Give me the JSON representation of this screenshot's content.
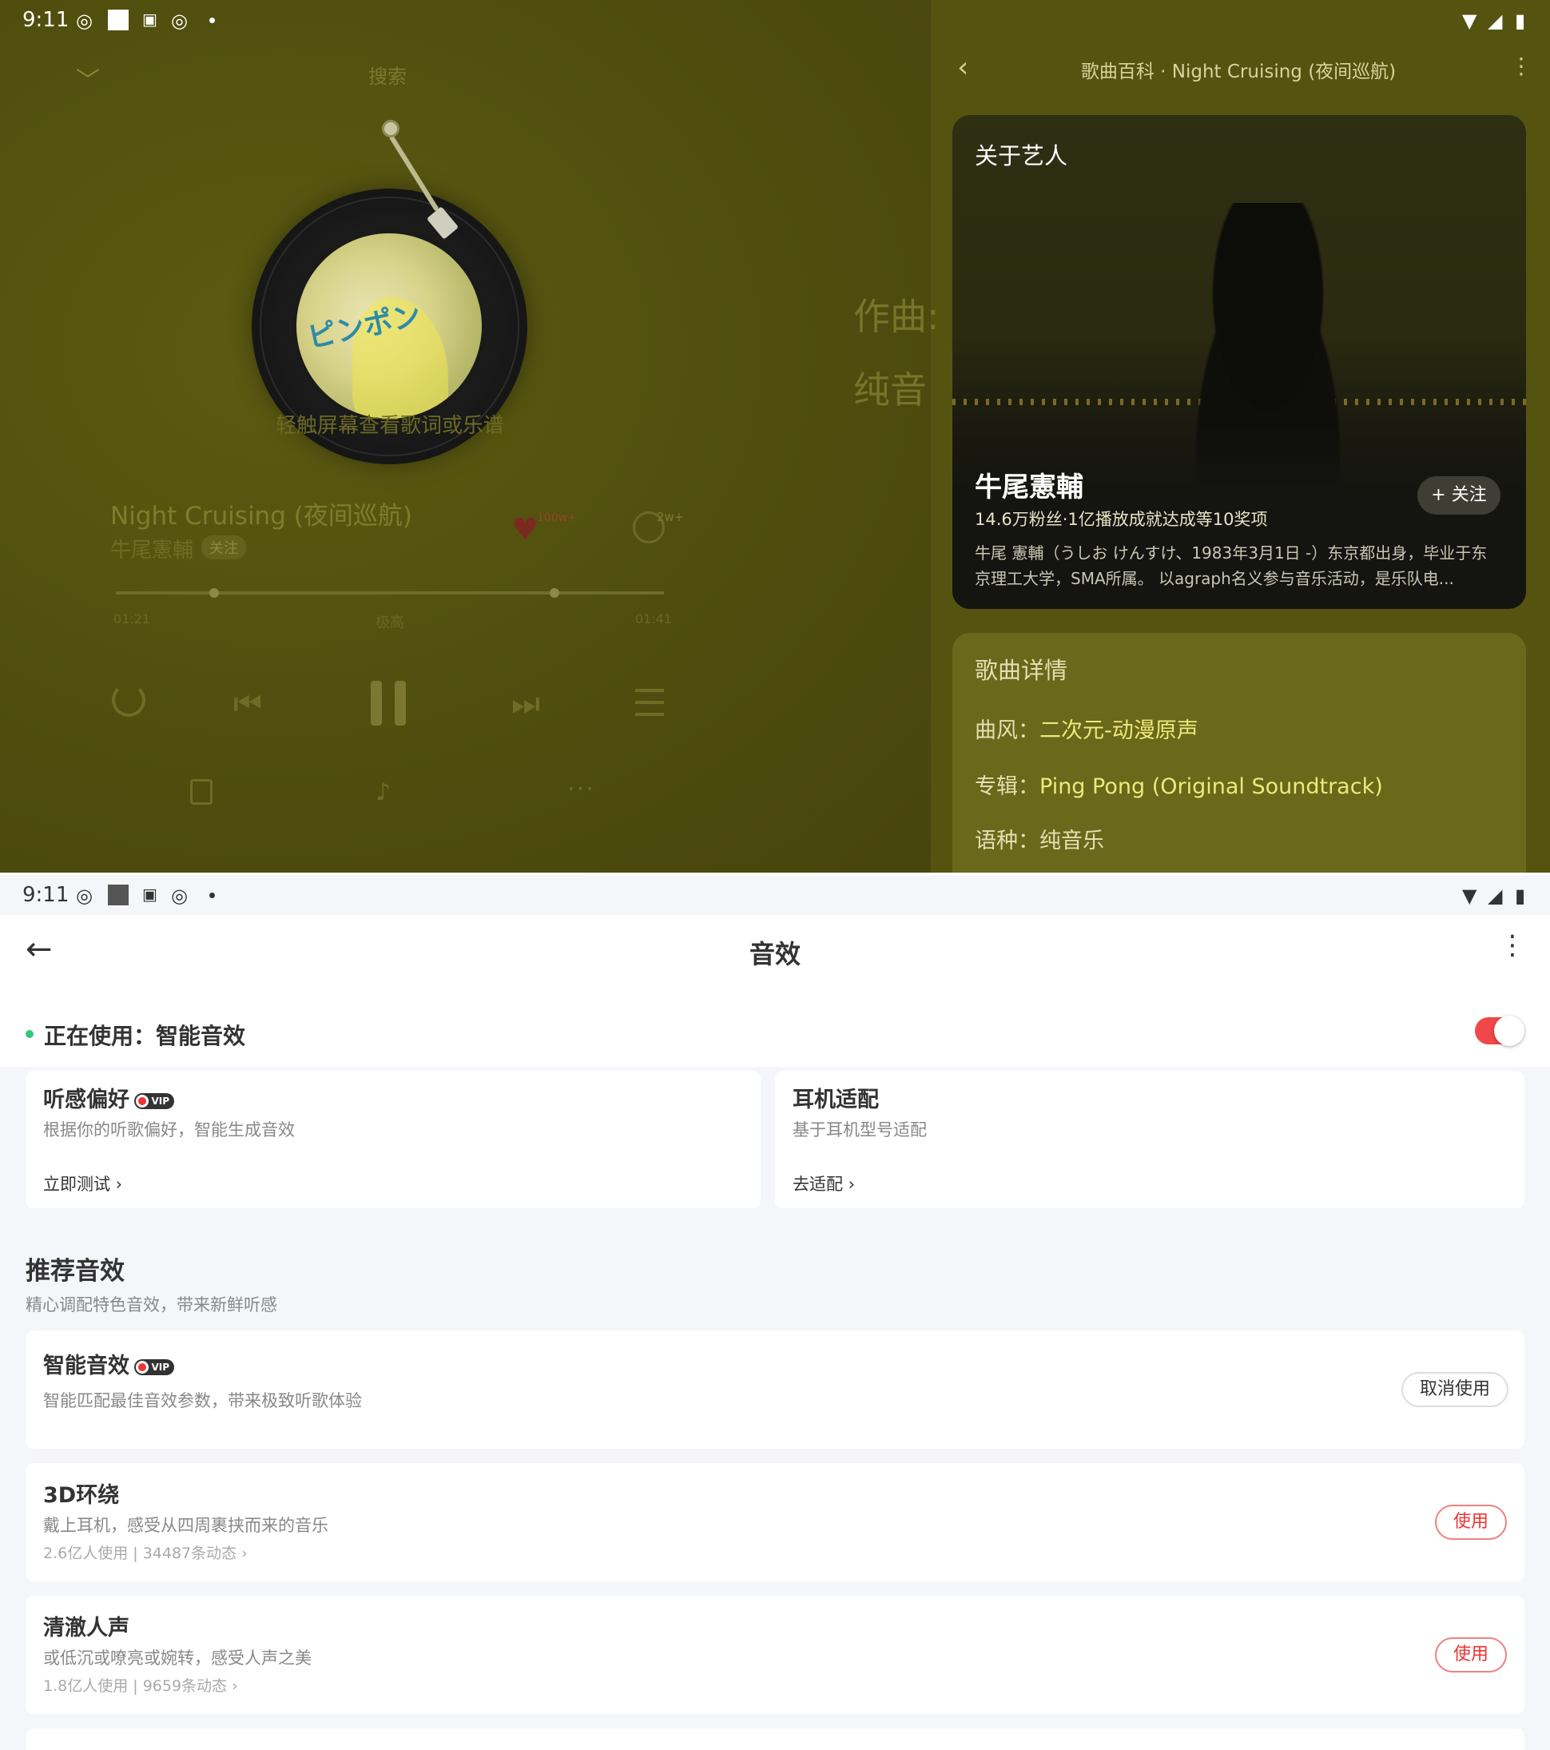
{
  "top": {
    "status": {
      "time": "9:11"
    },
    "player": {
      "search_label": "搜索",
      "tap_hint": "轻触屏幕查看歌词或乐谱",
      "song_title": "Night Cruising (夜间巡航)",
      "artist": "牛尾憲輔",
      "follow_chip": "关注",
      "like_count": "100w+",
      "comment_count": "2w+",
      "time_current": "01:21",
      "time_total": "01:41",
      "quality": "极高",
      "progress_fraction": 0.18,
      "buffer_fraction": 0.8,
      "lyric_line1": "作曲:",
      "lyric_line2": "纯音"
    },
    "wiki": {
      "title": "歌曲百科 · Night Cruising (夜间巡航)",
      "artist_card": {
        "heading": "关于艺人",
        "name": "牛尾憲輔",
        "stats": "14.6万粉丝·1亿播放成就达成等10奖项",
        "follow_label": "+ 关注",
        "bio": "牛尾 憲輔（うしお けんすけ、1983年3月1日 -）东京都出身，毕业于东京理工大学，SMA所属。 以agraph名义参与音乐活动，是乐队电..."
      },
      "detail_card": {
        "heading": "歌曲详情",
        "genre_label": "曲风：",
        "genre_value": "二次元-动漫原声",
        "album_label": "专辑：",
        "album_value": "Ping Pong (Original Soundtrack)",
        "language_label": "语种：",
        "language_value": "纯音乐"
      }
    }
  },
  "bottom": {
    "status": {
      "time": "9:11"
    },
    "header": {
      "title": "音效"
    },
    "in_use": {
      "label": "正在使用：智能音效",
      "toggle_on": true
    },
    "cards": {
      "preference": {
        "title": "听感偏好",
        "vip": "VIP",
        "desc": "根据你的听歌偏好，智能生成音效",
        "link": "立即测试"
      },
      "earphone": {
        "title": "耳机适配",
        "desc": "基于耳机型号适配",
        "link": "去适配"
      }
    },
    "recommend": {
      "title": "推荐音效",
      "subtitle": "精心调配特色音效，带来新鲜听感",
      "items": [
        {
          "title": "智能音效",
          "vip": "VIP",
          "desc": "智能匹配最佳音效参数，带来极致听歌体验",
          "meta": "",
          "button": "取消使用"
        },
        {
          "title": "3D环绕",
          "desc": "戴上耳机，感受从四周裹挟而来的音乐",
          "meta": "2.6亿人使用 | 34487条动态",
          "button": "使用"
        },
        {
          "title": "清澈人声",
          "desc": "或低沉或嘹亮或婉转，感受人声之美",
          "meta": "1.8亿人使用 | 9659条动态",
          "button": "使用"
        }
      ]
    },
    "colors": {
      "accent": "#f04848",
      "online_dot": "#35c47a"
    }
  }
}
